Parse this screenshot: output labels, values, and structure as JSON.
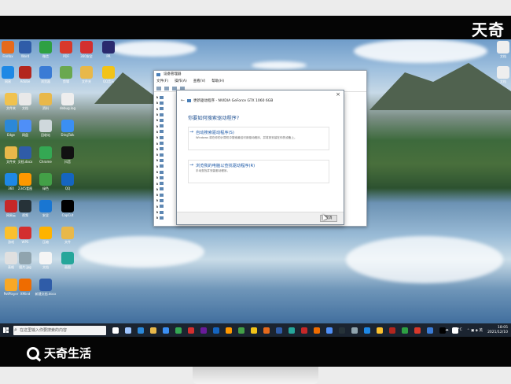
{
  "watermark": {
    "top": "天奇",
    "bottom": "天奇生活"
  },
  "desktop": {
    "left_icons": [
      {
        "label": "Firefox",
        "color": "#e66a1c"
      },
      {
        "label": "Word",
        "color": "#2f5ca8"
      },
      {
        "label": "微信",
        "color": "#2ea043"
      },
      {
        "label": "PDF",
        "color": "#d8392b"
      },
      {
        "label": "360安全",
        "color": "#d32f2f"
      },
      {
        "label": "PR",
        "color": "#2a2a6e"
      },
      {
        "label": "网易",
        "color": "#1e88e5"
      },
      {
        "label": "Adobe",
        "color": "#b3261e"
      },
      {
        "label": "浏览器",
        "color": "#3a7bd5"
      },
      {
        "label": "剪辑",
        "color": "#6aa84f"
      },
      {
        "label": "文件夹",
        "color": "#e8b84a"
      },
      {
        "label": "QQ音乐",
        "color": "#f2c318"
      },
      {
        "label": "文件夹",
        "color": "#f0c24f"
      },
      {
        "label": "文档",
        "color": "#e9e9e9"
      },
      {
        "label": "资料",
        "color": "#e8b84a"
      },
      {
        "label": "debug.log",
        "color": "#eeeeee"
      },
      {
        "label": "Edge",
        "color": "#2b88d8"
      },
      {
        "label": "网盘",
        "color": "#4f8ff7"
      },
      {
        "label": "回收站",
        "color": "#cfd8dc"
      },
      {
        "label": "DingTalk",
        "color": "#3b8ff3"
      },
      {
        "label": "文件夹",
        "color": "#e8b84a"
      },
      {
        "label": "文档.docx",
        "color": "#2f5ca8"
      },
      {
        "label": "Chrome",
        "color": "#34a853"
      },
      {
        "label": "抖音",
        "color": "#111111"
      },
      {
        "label": "360",
        "color": "#1e88e5"
      },
      {
        "label": "2345看图",
        "color": "#ff9800"
      },
      {
        "label": "绿色",
        "color": "#43a047"
      },
      {
        "label": "QQ",
        "color": "#1565c0"
      },
      {
        "label": "网易云",
        "color": "#c62828"
      },
      {
        "label": "视频",
        "color": "#263238"
      },
      {
        "label": "安全",
        "color": "#1976d2"
      },
      {
        "label": "CapCut",
        "color": "#000000"
      },
      {
        "label": "游戏",
        "color": "#fbc02d"
      },
      {
        "label": "WPS",
        "color": "#d32f2f"
      },
      {
        "label": "压缩",
        "color": "#ffb300"
      },
      {
        "label": "文件",
        "color": "#e8b84a"
      },
      {
        "label": "表格",
        "color": "#e0e0e0"
      },
      {
        "label": "图片.jpg",
        "color": "#90a4ae"
      },
      {
        "label": "文档",
        "color": "#f5f5f5"
      },
      {
        "label": "画图",
        "color": "#26a69a"
      },
      {
        "label": "PotPlayer",
        "color": "#f9a825"
      },
      {
        "label": "XMind",
        "color": "#ef6c00"
      },
      {
        "label": "新建文档.docx",
        "color": "#2f5ca8"
      }
    ],
    "right_icons": [
      {
        "label": "文档",
        "color": "#eeeeee"
      },
      {
        "label": "文档",
        "color": "#eeeeee"
      }
    ]
  },
  "taskbar": {
    "search_placeholder": "在这里输入你要搜索的内容",
    "apps": [
      "#ffffff",
      "#9ec5ff",
      "#2b88d8",
      "#e8b84a",
      "#3b8ff3",
      "#34a853",
      "#d32f2f",
      "#6a1b9a",
      "#1565c0",
      "#ff9800",
      "#43a047",
      "#f2c318",
      "#e66a1c",
      "#2f5ca8",
      "#26a69a",
      "#c62828",
      "#ef6c00",
      "#4f8ff7",
      "#263238",
      "#90a4ae",
      "#1e88e5",
      "#fbc02d",
      "#b3261e",
      "#2ea043",
      "#d8392b",
      "#3a7bd5",
      "#000000",
      "#ffffff"
    ],
    "weather": "14°C",
    "time": "18:05",
    "date": "2021/12/10"
  },
  "device_manager": {
    "title": "设备管理器",
    "menu": [
      "文件(F)",
      "操作(A)",
      "查看(V)",
      "帮助(H)"
    ],
    "tree_count": 22
  },
  "update_dialog": {
    "header": "更新驱动程序 - NVIDIA GeForce GTX 1060 6GB",
    "question": "你要如何搜索驱动程序?",
    "option1_title": "自动搜索驱动程序(S)",
    "option1_desc": "Windows 将在你的计算机中搜索最佳可用驱动程序，并将其安装在你的设备上。",
    "option2_title": "浏览我的电脑以查找驱动程序(R)",
    "option2_desc": "手动查找并安装驱动程序。",
    "cancel": "取消",
    "close": "×"
  }
}
